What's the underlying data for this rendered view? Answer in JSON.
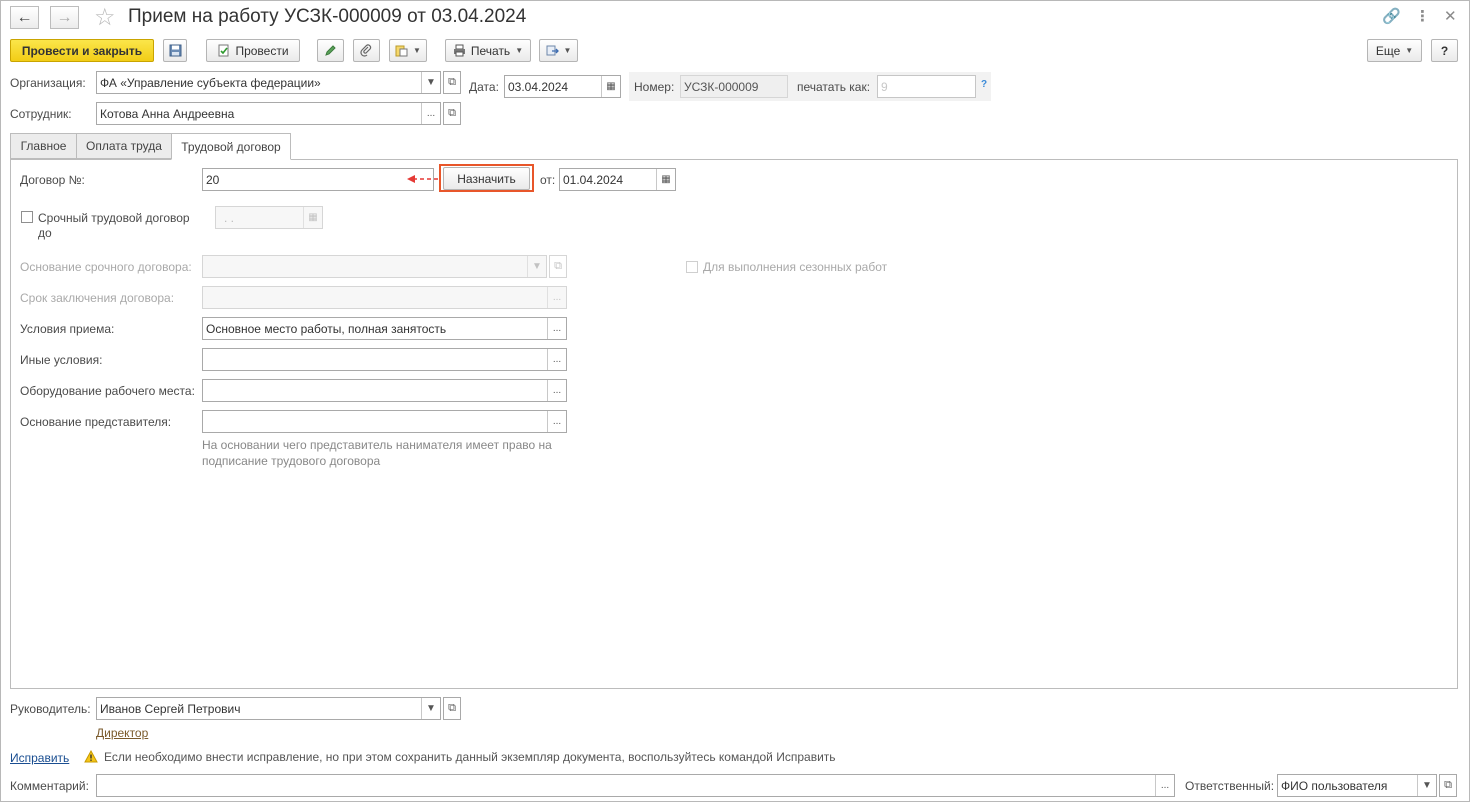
{
  "window": {
    "title": "Прием на работу УСЗК-000009 от 03.04.2024"
  },
  "toolbar": {
    "post_and_close": "Провести и закрыть",
    "post": "Провести",
    "print": "Печать",
    "more": "Еще",
    "help": "?"
  },
  "header": {
    "organization_label": "Организация:",
    "organization_value": "ФА «Управление субъекта федерации»",
    "date_label": "Дата:",
    "date_value": "03.04.2024",
    "number_label": "Номер:",
    "number_value": "УСЗК-000009",
    "print_as_label": "печатать как:",
    "print_as_placeholder": "9",
    "question_mark": "?",
    "employee_label": "Сотрудник:",
    "employee_value": "Котова Анна Андреевна"
  },
  "tabs": [
    {
      "label": "Главное"
    },
    {
      "label": "Оплата труда"
    },
    {
      "label": "Трудовой договор"
    }
  ],
  "contract": {
    "number_label": "Договор №:",
    "number_value": "20",
    "assign_button": "Назначить",
    "from_label": "от:",
    "from_value": "01.04.2024",
    "fixed_term_label_1": "Срочный трудовой договор",
    "fixed_term_label_2": "до",
    "fixed_term_date": ". .",
    "seasonal_label": "Для выполнения сезонных работ",
    "basis_label": "Основание срочного договора:",
    "term_label": "Срок заключения договора:",
    "conditions_label": "Условия приема:",
    "conditions_value": "Основное место работы, полная занятость",
    "other_label": "Иные условия:",
    "equipment_label": "Оборудование рабочего места:",
    "rep_basis_label": "Основание представителя:",
    "rep_hint": "На основании чего представитель нанимателя имеет право на подписание трудового договора"
  },
  "footer": {
    "manager_label": "Руководитель:",
    "manager_value": "Иванов Сергей Петрович",
    "manager_position": "Директор",
    "fix_link": "Исправить",
    "fix_hint": "Если необходимо внести исправление, но при этом сохранить данный экземпляр документа, воспользуйтесь командой Исправить",
    "comment_label": "Комментарий:",
    "responsible_label": "Ответственный:",
    "responsible_value": "ФИО пользователя"
  },
  "colors": {
    "primary_button": "#f2cd16",
    "highlight": "#e8562a",
    "link": "#1a4e91"
  }
}
